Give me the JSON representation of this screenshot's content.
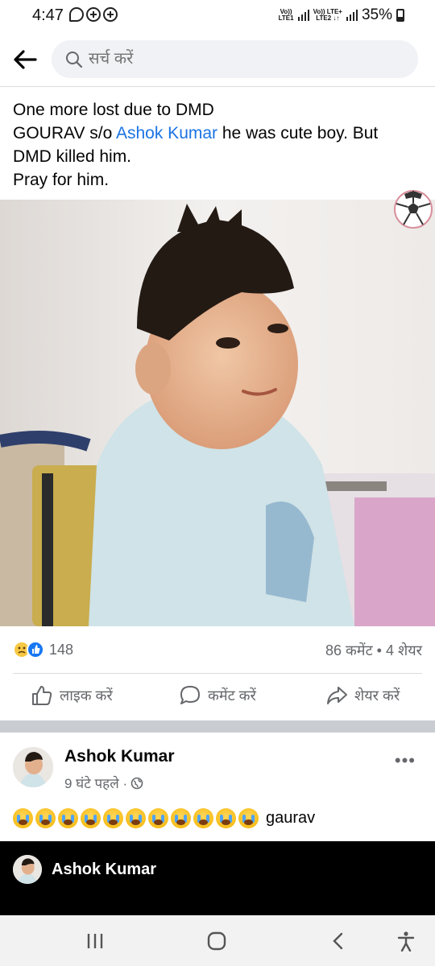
{
  "status_bar": {
    "time": "4:47",
    "battery": "35%",
    "sim1_label": "Vo)) LTE1",
    "sim2_label": "Vo)) LTE+ LTE2"
  },
  "search": {
    "placeholder": "सर्च करें"
  },
  "post": {
    "line1": "One more lost due to DMD",
    "line2_prefix": "GOURAV s/o ",
    "mention": "Ashok Kumar",
    "line2_suffix": " he was cute boy. But",
    "line3": "DMD killed him.",
    "line4": "Pray for him."
  },
  "reactions": {
    "count": "148",
    "stats": "86 कमेंट • 4 शेयर"
  },
  "actions": {
    "like": "लाइक करें",
    "comment": "कमेंट करें",
    "share": "शेयर करें"
  },
  "comment": {
    "author": "Ashok Kumar",
    "time": "9 घंटे पहले ·",
    "emoji_count": 11,
    "text": "gaurav"
  },
  "reply_bar": {
    "name": "Ashok Kumar"
  },
  "colors": {
    "accent": "#1b74e4",
    "secondary_text": "#65676b"
  }
}
